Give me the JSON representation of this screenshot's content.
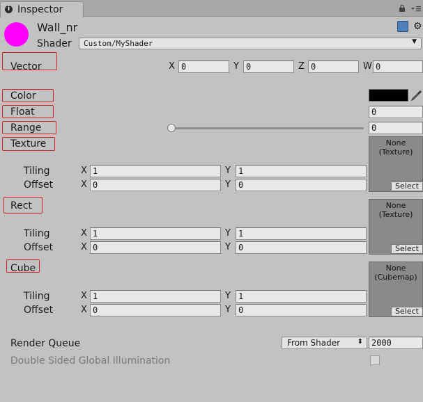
{
  "tab": {
    "label": "Inspector"
  },
  "material": {
    "name": "Wall_nr",
    "preview_color": "#ff00ff"
  },
  "shader": {
    "label": "Shader",
    "value": "Custom/MyShader"
  },
  "vector": {
    "label": "Vector",
    "x_label": "X",
    "x": "0",
    "y_label": "Y",
    "y": "0",
    "z_label": "Z",
    "z": "0",
    "w_label": "W",
    "w": "0"
  },
  "color": {
    "label": "Color",
    "value": "#000000"
  },
  "float": {
    "label": "Float",
    "value": "0"
  },
  "range": {
    "label": "Range",
    "value": "0",
    "fraction": 0
  },
  "texture": {
    "label": "Texture",
    "slot_line1": "None",
    "slot_line2": "(Texture)",
    "select": "Select",
    "tiling_label": "Tiling",
    "tiling_x": "1",
    "tiling_y": "1",
    "offset_label": "Offset",
    "offset_x": "0",
    "offset_y": "0"
  },
  "rect": {
    "label": "Rect",
    "slot_line1": "None",
    "slot_line2": "(Texture)",
    "select": "Select",
    "tiling_label": "Tiling",
    "tiling_x": "1",
    "tiling_y": "1",
    "offset_label": "Offset",
    "offset_x": "0",
    "offset_y": "0"
  },
  "cube": {
    "label": "Cube",
    "slot_line1": "None",
    "slot_line2": "(Cubemap)",
    "select": "Select",
    "tiling_label": "Tiling",
    "tiling_x": "1",
    "tiling_y": "1",
    "offset_label": "Offset",
    "offset_x": "0",
    "offset_y": "0"
  },
  "axis": {
    "x": "X",
    "y": "Y"
  },
  "render_queue": {
    "label": "Render Queue",
    "mode": "From Shader",
    "value": "2000"
  },
  "double_sided_gi": {
    "label": "Double Sided Global Illumination",
    "checked": false
  },
  "highlight_color": "#d32020"
}
